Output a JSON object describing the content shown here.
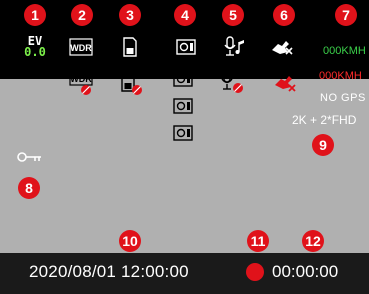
{
  "badges": [
    "1",
    "2",
    "3",
    "4",
    "5",
    "6",
    "7",
    "8",
    "9",
    "10",
    "11",
    "12"
  ],
  "ev": {
    "label": "EV",
    "value": "0.0"
  },
  "icons": {
    "wdr_label": "WDR",
    "wdr_off_label": "WDR"
  },
  "speed": {
    "green": "000KMH",
    "red": "000KMH"
  },
  "gps_status": "NO  GPS",
  "resolution": "2K + 2*FHD",
  "datetime": "2020/08/01 12:00:00",
  "record_time": "00:00:00",
  "colors": {
    "badge": "#e0121a",
    "speed_ok": "#3bd04a",
    "speed_alert": "#ff2a2a",
    "ev_value": "#7cf04a",
    "middle_bg": "#b0b0b0"
  }
}
